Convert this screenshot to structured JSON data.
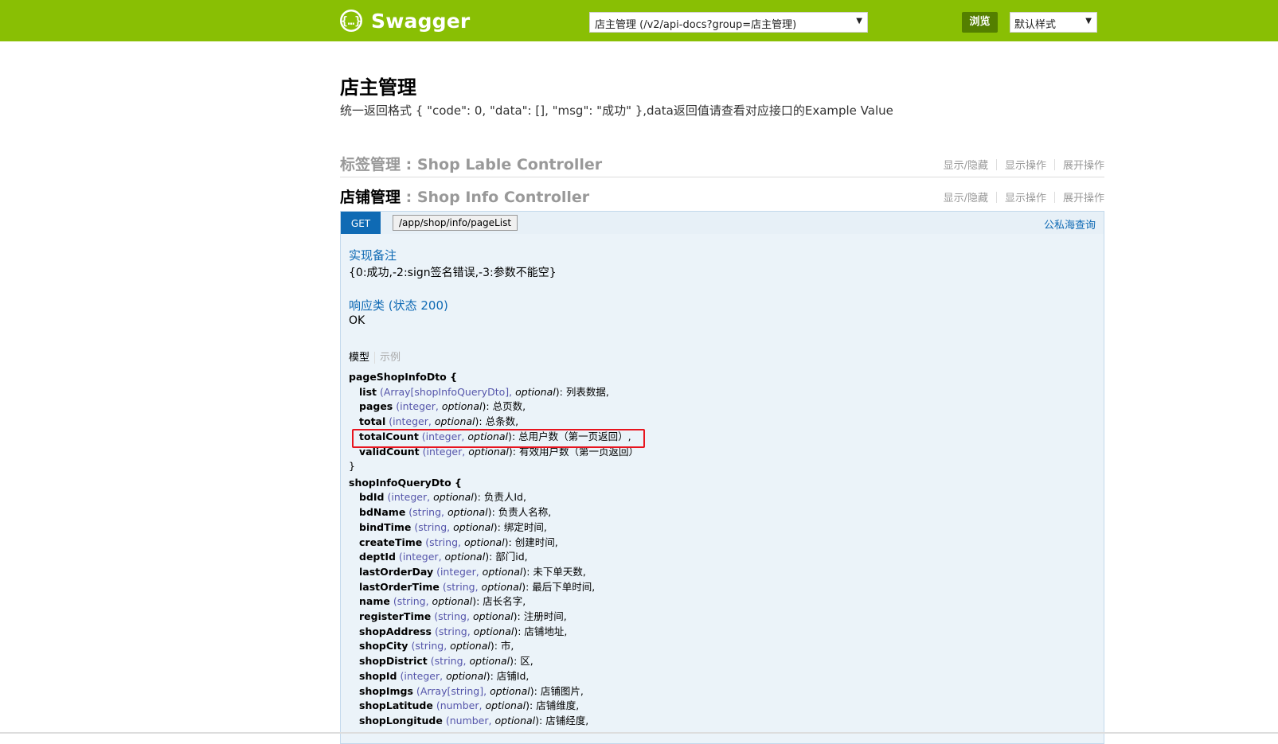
{
  "header": {
    "app_name": "Swagger",
    "api_select_value": "店主管理 (/v2/api-docs?group=店主管理)",
    "explore_label": "浏览",
    "style_select_value": "默认样式",
    "brand_color": "#89bf04"
  },
  "page": {
    "title": "店主管理",
    "description": "统一返回格式 { \"code\": 0, \"data\": [], \"msg\": \"成功\" },data返回值请查看对应接口的Example Value"
  },
  "controllers": [
    {
      "name_zh": "标签管理",
      "name_en": " : Shop Lable Controller",
      "links": [
        "显示/隐藏",
        "显示操作",
        "展开操作"
      ]
    },
    {
      "name_zh": "店铺管理",
      "name_en": " : Shop Info Controller",
      "links": [
        "显示/隐藏",
        "显示操作",
        "展开操作"
      ]
    }
  ],
  "operation": {
    "method": "GET",
    "path": "/app/shop/info/pageList",
    "summary": "公私海查询",
    "method_color": "#0f6ab4",
    "notes_title": "实现备注",
    "notes_text": "{0:成功,-2:sign签名错误,-3:参数不能空}",
    "response_title": "响应类 (状态 200)",
    "response_text": "OK",
    "tab_model": "模型",
    "tab_example": "示例"
  },
  "models": {
    "page": {
      "open": "pageShopInfoDto {",
      "close": "}",
      "fields": [
        {
          "name": "list",
          "type": "Array[shopInfoQueryDto]",
          "opt": "optional",
          "desc": ": 列表数据,"
        },
        {
          "name": "pages",
          "type": "integer",
          "opt": "optional",
          "desc": ": 总页数,"
        },
        {
          "name": "total",
          "type": "integer",
          "opt": "optional",
          "desc": ": 总条数,"
        },
        {
          "name": "totalCount",
          "type": "integer",
          "opt": "optional",
          "desc": ": 总用户数（第一页返回）,"
        },
        {
          "name": "validCount",
          "type": "integer",
          "opt": "optional",
          "desc": ": 有效用户数（第一页返回）"
        }
      ]
    },
    "query": {
      "open": "shopInfoQueryDto {",
      "fields": [
        {
          "name": "bdId",
          "type": "integer",
          "opt": "optional",
          "desc": ": 负责人Id,"
        },
        {
          "name": "bdName",
          "type": "string",
          "opt": "optional",
          "desc": ": 负责人名称,"
        },
        {
          "name": "bindTime",
          "type": "string",
          "opt": "optional",
          "desc": ": 绑定时间,"
        },
        {
          "name": "createTime",
          "type": "string",
          "opt": "optional",
          "desc": ": 创建时间,"
        },
        {
          "name": "deptId",
          "type": "integer",
          "opt": "optional",
          "desc": ": 部门id,"
        },
        {
          "name": "lastOrderDay",
          "type": "integer",
          "opt": "optional",
          "desc": ": 未下单天数,"
        },
        {
          "name": "lastOrderTime",
          "type": "string",
          "opt": "optional",
          "desc": ": 最后下单时间,"
        },
        {
          "name": "name",
          "type": "string",
          "opt": "optional",
          "desc": ": 店长名字,"
        },
        {
          "name": "registerTime",
          "type": "string",
          "opt": "optional",
          "desc": ": 注册时间,"
        },
        {
          "name": "shopAddress",
          "type": "string",
          "opt": "optional",
          "desc": ": 店铺地址,"
        },
        {
          "name": "shopCity",
          "type": "string",
          "opt": "optional",
          "desc": ": 市,"
        },
        {
          "name": "shopDistrict",
          "type": "string",
          "opt": "optional",
          "desc": ": 区,"
        },
        {
          "name": "shopId",
          "type": "integer",
          "opt": "optional",
          "desc": ": 店铺Id,"
        },
        {
          "name": "shopImgs",
          "type": "Array[string]",
          "opt": "optional",
          "desc": ": 店铺图片,"
        },
        {
          "name": "shopLatitude",
          "type": "number",
          "opt": "optional",
          "desc": ": 店铺维度,"
        },
        {
          "name": "shopLongitude",
          "type": "number",
          "opt": "optional",
          "desc": ": 店铺经度,"
        }
      ]
    }
  }
}
